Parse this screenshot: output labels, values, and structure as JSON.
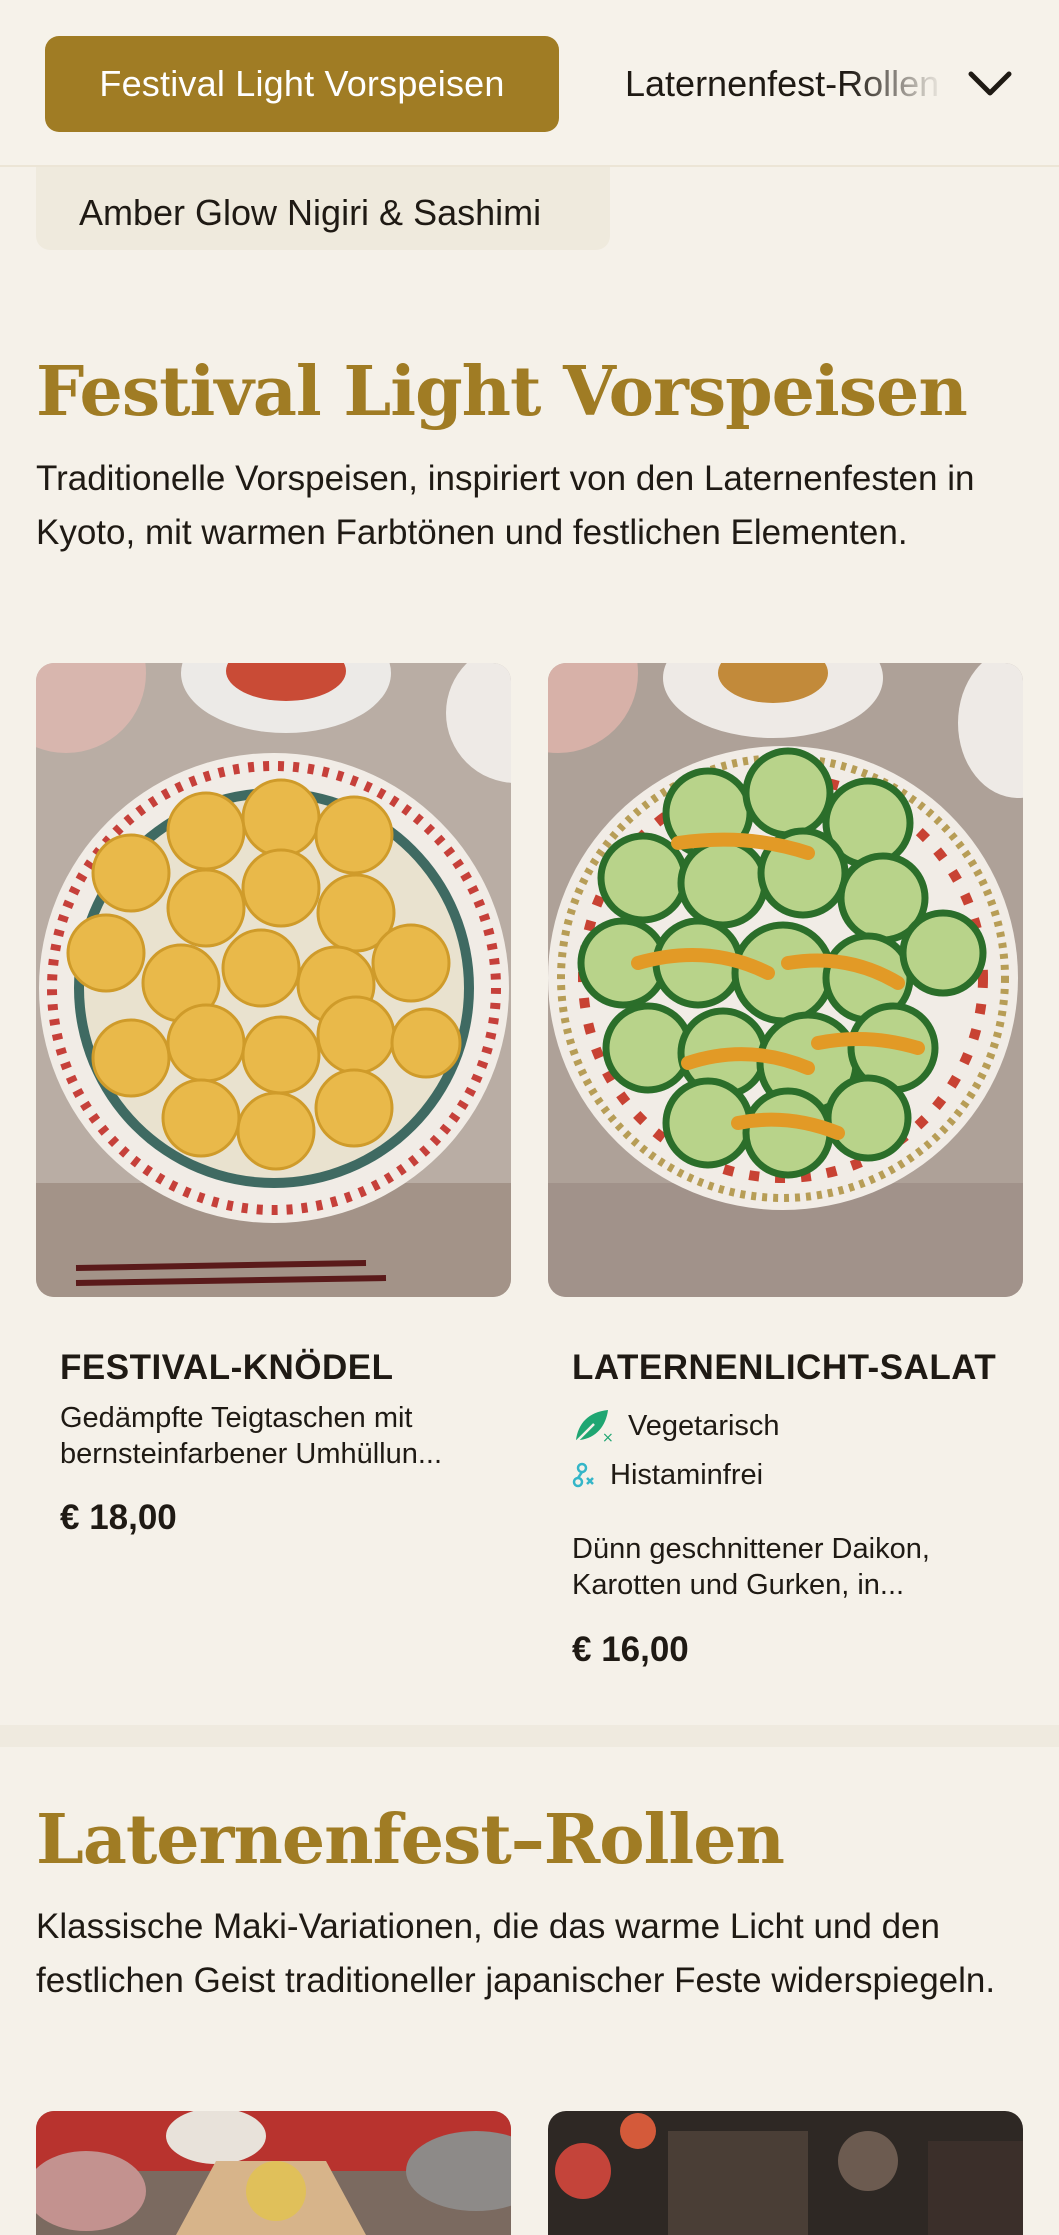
{
  "nav": {
    "active_category": "Festival Light Vorspeisen",
    "next_category": "Laternenfest-Rollen",
    "secondary_category": "Amber Glow Nigiri & Sashimi",
    "expand_icon": "chevron-down-icon"
  },
  "sections": [
    {
      "title": "Festival Light Vorspeisen",
      "description": "Traditionelle Vorspeisen, inspiriert von den Laternenfesten in Kyoto, mit warmen Farbtönen und festlichen Elementen.",
      "dishes": [
        {
          "name": "FESTIVAL-KNÖDEL",
          "description": "Gedämpfte Teigtaschen mit bernsteinfarbener Umhüllun...",
          "price": "€ 18,00",
          "tags": []
        },
        {
          "name": "LATERNENLICHT-SALAT",
          "tags": [
            {
              "label": "Vegetarisch",
              "icon": "vegetarian-leaf-icon"
            },
            {
              "label": "Histaminfrei",
              "icon": "histamine-free-icon"
            }
          ],
          "description": "Dünn geschnittener Daikon, Karotten und Gurken, in...",
          "price": "€ 16,00"
        }
      ]
    },
    {
      "title": "Laternenfest–Rollen",
      "description": "Klassische Maki-Variationen, die das warme Licht und den festlichen Geist traditioneller japanischer Feste widerspiegeln."
    }
  ],
  "colors": {
    "accent": "#a07c24",
    "background": "#f5f1e9",
    "vegetarian": "#1fa672",
    "histamine": "#35b6c8"
  }
}
